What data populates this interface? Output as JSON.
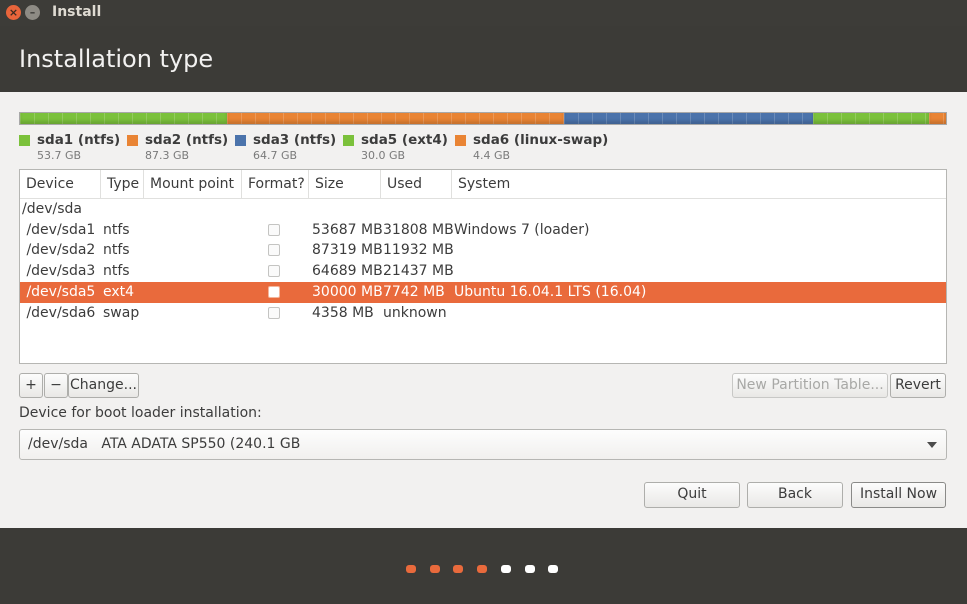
{
  "window": {
    "title": "Install",
    "close_glyph": "×",
    "min_glyph": "–"
  },
  "header": {
    "page_title": "Installation type"
  },
  "colors": {
    "ntfs_green": "#7bc13b",
    "ntfs_orange": "#e98434",
    "ntfs_blue": "#4b73ab",
    "swap_orange": "#e98434",
    "accent": "#e96a3c"
  },
  "partition_bar": [
    {
      "name": "sda1",
      "size_gb": 53.7,
      "color": "#7bc13b"
    },
    {
      "name": "sda2",
      "size_gb": 87.3,
      "color": "#e98434"
    },
    {
      "name": "sda3",
      "size_gb": 64.7,
      "color": "#4b73ab"
    },
    {
      "name": "sda5",
      "size_gb": 30.0,
      "color": "#7bc13b"
    },
    {
      "name": "sda6",
      "size_gb": 4.4,
      "color": "#e98434"
    }
  ],
  "legend": [
    {
      "label": "sda1 (ntfs)",
      "size": "53.7 GB",
      "color": "#7bc13b"
    },
    {
      "label": "sda2 (ntfs)",
      "size": "87.3 GB",
      "color": "#e98434"
    },
    {
      "label": "sda3 (ntfs)",
      "size": "64.7 GB",
      "color": "#4b73ab"
    },
    {
      "label": "sda5 (ext4)",
      "size": "30.0 GB",
      "color": "#7bc13b"
    },
    {
      "label": "sda6 (linux-swap)",
      "size": "4.4 GB",
      "color": "#e98434"
    }
  ],
  "table": {
    "headers": [
      "Device",
      "Type",
      "Mount point",
      "Format?",
      "Size",
      "Used",
      "System"
    ],
    "rows": [
      {
        "device": "/dev/sda",
        "type": "",
        "mount": "",
        "format": null,
        "size": "",
        "used": "",
        "system": "",
        "selected": false
      },
      {
        "device": " /dev/sda1",
        "type": "ntfs",
        "mount": "",
        "format": false,
        "size": "53687 MB",
        "used": "31808 MB",
        "system": "Windows 7 (loader)",
        "selected": false
      },
      {
        "device": " /dev/sda2",
        "type": "ntfs",
        "mount": "",
        "format": false,
        "size": "87319 MB",
        "used": "11932 MB",
        "system": "",
        "selected": false
      },
      {
        "device": " /dev/sda3",
        "type": "ntfs",
        "mount": "",
        "format": false,
        "size": "64689 MB",
        "used": "21437 MB",
        "system": "",
        "selected": false
      },
      {
        "device": " /dev/sda5",
        "type": "ext4",
        "mount": "",
        "format": false,
        "size": "30000 MB",
        "used": "7742 MB",
        "system": "Ubuntu 16.04.1 LTS (16.04)",
        "selected": true
      },
      {
        "device": " /dev/sda6",
        "type": "swap",
        "mount": "",
        "format": false,
        "size": "4358 MB",
        "used": "unknown",
        "system": "",
        "selected": false
      }
    ]
  },
  "toolbar": {
    "add_label": "+",
    "remove_label": "−",
    "change_label": "Change...",
    "new_table_label": "New Partition Table...",
    "revert_label": "Revert"
  },
  "boot": {
    "label": "Device for boot loader installation:",
    "selected": "/dev/sda   ATA ADATA SP550 (240.1 GB"
  },
  "actions": {
    "quit_label": "Quit",
    "back_label": "Back",
    "install_label": "Install Now"
  },
  "progress": {
    "total_steps": 7,
    "completed_steps": 4,
    "done_color": "#e96a3c",
    "todo_color": "#ffffff"
  }
}
